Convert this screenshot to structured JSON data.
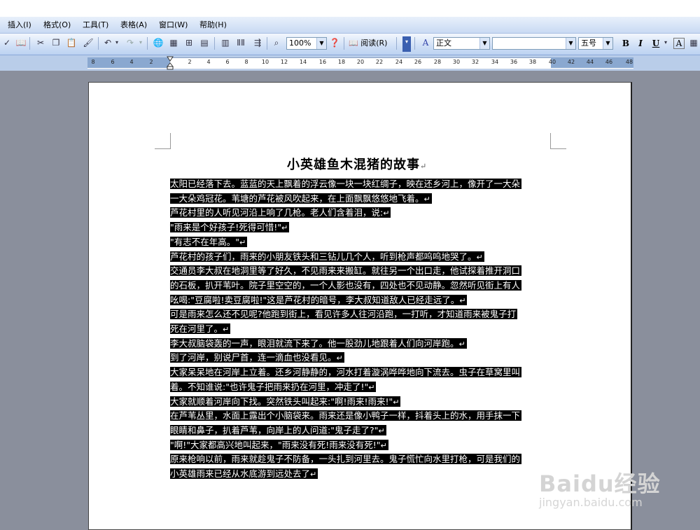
{
  "menu": {
    "items": [
      "插入(I)",
      "格式(O)",
      "工具(T)",
      "表格(A)",
      "窗口(W)",
      "帮助(H)"
    ]
  },
  "toolbar": {
    "zoom": "100%",
    "read_label": "阅读(R)",
    "style_value": "正文",
    "font_value": "",
    "size_value": "五号",
    "bold": "B",
    "italic": "I",
    "underline": "U",
    "font_color": "A"
  },
  "ruler": {
    "labels": [
      "8",
      "6",
      "4",
      "2",
      "2",
      "4",
      "6",
      "8",
      "10",
      "12",
      "14",
      "16",
      "18",
      "20",
      "22",
      "24",
      "26",
      "28",
      "30",
      "32",
      "34",
      "36",
      "38",
      "40",
      "42",
      "44",
      "46",
      "48"
    ]
  },
  "document": {
    "title": "小英雄鱼木混猪的故事",
    "paragraph_mark": "↵",
    "lines": [
      "太阳已经落下去。蓝蓝的天上飘着的浮云像一块一块红绸子，映在还乡河上，像开了一大朵",
      "一大朵鸡冠花。苇塘的芦花被风吹起来，在上面飘飘悠悠地飞着。",
      "芦花村里的人听见河沿上响了几枪。老人们含着泪，说:",
      "\"雨来是个好孩子!死得可惜!\"",
      "\"有志不在年高。\"",
      "芦花村的孩子们，雨来的小朋友铁头和三钻儿几个人，听到枪声都呜呜地哭了。",
      "交通员李大叔在地洞里等了好久，不见雨来来搬缸。就往另一个出口走，他试探着推开洞口",
      "的石板，扒开苇叶。院子里空空的，一个人影也没有，四处也不见动静。忽然听见街上有人",
      "吆喝:\"豆腐啦!卖豆腐啦!\"这是芦花村的暗号，李大叔知道敌人已经走远了。",
      "可是雨来怎么还不见呢?他跑到街上，看见许多人往河沿跑，一打听，才知道雨来被鬼子打",
      "死在河里了。",
      "李大叔脑袋轰的一声，眼泪就流下来了。他一股劲儿地跟着人们向河岸跑。",
      "到了河岸，别说尸首，连一滴血也没看见。",
      "大家呆呆地在河岸上立着。还乡河静静的，河水打着漩涡哗哗地向下流去。虫子在草窝里叫",
      "着。不知谁说:\"也许鬼子把雨来扔在河里，冲走了!\"",
      "大家就顺着河岸向下找。突然铁头叫起来:\"啊!雨来!雨来!\"",
      "在芦苇丛里，水面上露出个小脑袋来。雨来还是像小鸭子一样，抖着头上的水，用手抹一下",
      "眼睛和鼻子，扒着芦苇，向岸上的人问道:\"鬼子走了?\"",
      "\"啊!\"大家都高兴地叫起来，\"雨来没有死!雨来没有死!\"",
      "原来枪响以前，雨来就趁鬼子不防备，一头扎到河里去。鬼子慌忙向水里打枪，可是我们的",
      "小英雄雨来已经从水底游到远处去了"
    ],
    "line_ends_paragraph": [
      false,
      true,
      true,
      true,
      true,
      true,
      false,
      false,
      true,
      false,
      true,
      true,
      true,
      false,
      true,
      true,
      false,
      true,
      true,
      false,
      true
    ]
  },
  "watermark": {
    "logo": "Baidu经验",
    "url": "jingyan.baidu.com"
  },
  "colors": {
    "selection": "#000000",
    "workspace": "#8a8f9c",
    "menubar": "#c9daf3"
  }
}
